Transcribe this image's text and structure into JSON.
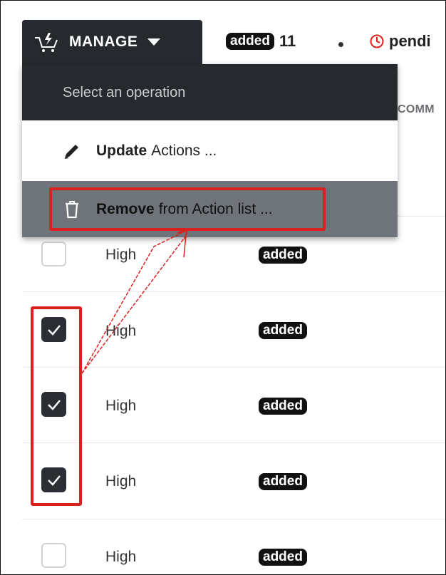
{
  "toolbar": {
    "manage_label": "MANAGE",
    "added_badge": "added",
    "added_count": "11",
    "pending_label": "pendi"
  },
  "table": {
    "column_header": "COMM",
    "rows": [
      {
        "checked": false,
        "priority": "High",
        "status": "added"
      },
      {
        "checked": true,
        "priority": "High",
        "status": "added"
      },
      {
        "checked": true,
        "priority": "High",
        "status": "added"
      },
      {
        "checked": true,
        "priority": "High",
        "status": "added"
      },
      {
        "checked": false,
        "priority": "High",
        "status": "added"
      }
    ]
  },
  "dropdown": {
    "header": "Select an operation",
    "items": [
      {
        "bold": "Update",
        "rest": "Actions ...",
        "icon": "pencil-icon"
      },
      {
        "bold": "Remove",
        "rest": "from Action list ...",
        "icon": "trash-icon"
      }
    ]
  },
  "colors": {
    "dark": "#262a2e",
    "highlight_row": "#6e7479",
    "annotation_red": "#d9211f",
    "pending_red": "#d9211f"
  }
}
